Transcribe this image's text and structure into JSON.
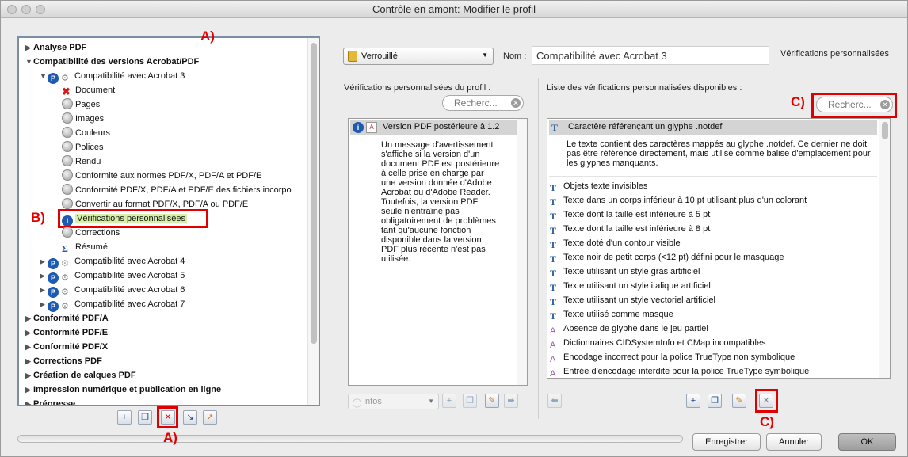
{
  "window": {
    "title": "Contrôle en amont: Modifier le profil"
  },
  "annotations": {
    "a_top": "A)",
    "a_bottom": "A)",
    "b": "B)",
    "c_top": "C)",
    "c_bottom": "C)"
  },
  "tree": {
    "items": [
      {
        "label": "Analyse PDF",
        "arrow": "▶",
        "bold": true,
        "indent": 0,
        "icon": ""
      },
      {
        "label": "Compatibilité des versions Acrobat/PDF",
        "arrow": "▼",
        "bold": true,
        "indent": 0,
        "icon": ""
      },
      {
        "label": "Compatibilité avec Acrobat 3",
        "arrow": "▼",
        "bold": false,
        "indent": 1,
        "icon": "profile-icon"
      },
      {
        "label": "Document",
        "arrow": "",
        "bold": false,
        "indent": 2,
        "icon": "error-x-icon"
      },
      {
        "label": "Pages",
        "arrow": "",
        "bold": false,
        "indent": 2,
        "icon": "disc-icon"
      },
      {
        "label": "Images",
        "arrow": "",
        "bold": false,
        "indent": 2,
        "icon": "disc-icon"
      },
      {
        "label": "Couleurs",
        "arrow": "",
        "bold": false,
        "indent": 2,
        "icon": "disc-icon"
      },
      {
        "label": "Polices",
        "arrow": "",
        "bold": false,
        "indent": 2,
        "icon": "disc-icon"
      },
      {
        "label": "Rendu",
        "arrow": "",
        "bold": false,
        "indent": 2,
        "icon": "disc-icon"
      },
      {
        "label": "Conformité aux normes PDF/X, PDF/A et PDF/E",
        "arrow": "",
        "bold": false,
        "indent": 2,
        "icon": "disc-icon"
      },
      {
        "label": "Conformité PDF/X, PDF/A et PDF/E des fichiers incorpo",
        "arrow": "",
        "bold": false,
        "indent": 2,
        "icon": "disc-icon"
      },
      {
        "label": "Convertir au format PDF/X, PDF/A ou PDF/E",
        "arrow": "",
        "bold": false,
        "indent": 2,
        "icon": "disc-icon"
      },
      {
        "label": "Vérifications personnalisées",
        "arrow": "",
        "bold": false,
        "indent": 2,
        "icon": "custom-check-icon",
        "selected": true
      },
      {
        "label": "Corrections",
        "arrow": "",
        "bold": false,
        "indent": 2,
        "icon": "disc-icon"
      },
      {
        "label": "Résumé",
        "arrow": "",
        "bold": false,
        "indent": 2,
        "icon": "summary-icon"
      },
      {
        "label": "Compatibilité avec Acrobat 4",
        "arrow": "▶",
        "bold": false,
        "indent": 1,
        "icon": "profile-icon"
      },
      {
        "label": "Compatibilité avec Acrobat 5",
        "arrow": "▶",
        "bold": false,
        "indent": 1,
        "icon": "profile-icon"
      },
      {
        "label": "Compatibilité avec Acrobat 6",
        "arrow": "▶",
        "bold": false,
        "indent": 1,
        "icon": "profile-icon"
      },
      {
        "label": "Compatibilité avec Acrobat 7",
        "arrow": "▶",
        "bold": false,
        "indent": 1,
        "icon": "profile-icon"
      },
      {
        "label": "Conformité PDF/A",
        "arrow": "▶",
        "bold": true,
        "indent": 0,
        "icon": ""
      },
      {
        "label": "Conformité PDF/E",
        "arrow": "▶",
        "bold": true,
        "indent": 0,
        "icon": ""
      },
      {
        "label": "Conformité PDF/X",
        "arrow": "▶",
        "bold": true,
        "indent": 0,
        "icon": ""
      },
      {
        "label": "Corrections PDF",
        "arrow": "▶",
        "bold": true,
        "indent": 0,
        "icon": ""
      },
      {
        "label": "Création de calques PDF",
        "arrow": "▶",
        "bold": true,
        "indent": 0,
        "icon": ""
      },
      {
        "label": "Impression numérique et publication en ligne",
        "arrow": "▶",
        "bold": true,
        "indent": 0,
        "icon": ""
      },
      {
        "label": "Prépresse",
        "arrow": "▶",
        "bold": true,
        "indent": 0,
        "icon": ""
      }
    ]
  },
  "header": {
    "lock_value": "Verrouillé",
    "name_label": "Nom :",
    "name_value": "Compatibilité avec Acrobat 3",
    "right_label": "Vérifications personnalisées"
  },
  "profile_checks": {
    "title": "Vérifications personnalisées du profil :",
    "search_placeholder": "Recherc...",
    "item_title": "Version PDF postérieure à 1.2",
    "item_desc": "Un message d'avertissement s'affiche si la version d'un document PDF est postérieure à celle prise en charge par une version donnée d'Adobe Acrobat ou d'Adobe Reader. Toutefois, la version PDF seule n'entraîne pas obligatoirement de problèmes tant qu'aucune fonction disponible dans la version PDF plus récente n'est pas utilisée.",
    "infos_label": "Infos"
  },
  "available_checks": {
    "title": "Liste des vérifications personnalisées disponibles :",
    "search_placeholder": "Recherc...",
    "selected_title": "Caractère référençant un glyphe .notdef",
    "selected_desc": "Le texte contient des caractères mappés au glyphe .notdef. Ce dernier ne doit pas être référencé directement, mais utilisé comme balise d'emplacement pour les glyphes manquants.",
    "items": [
      {
        "label": "Objets texte invisibles",
        "icon": "text-check-icon"
      },
      {
        "label": "Texte dans un corps inférieur à 10 pt utilisant plus d'un colorant",
        "icon": "text-check-icon"
      },
      {
        "label": "Texte dont la taille est inférieure à 5 pt",
        "icon": "text-check-icon"
      },
      {
        "label": "Texte dont la taille est inférieure à 8 pt",
        "icon": "text-check-icon"
      },
      {
        "label": "Texte doté d'un contour visible",
        "icon": "text-check-icon"
      },
      {
        "label": "Texte noir de petit corps (<12 pt) défini pour le masquage",
        "icon": "text-check-icon"
      },
      {
        "label": "Texte utilisant un style gras artificiel",
        "icon": "text-check-icon"
      },
      {
        "label": "Texte utilisant un style italique artificiel",
        "icon": "text-check-icon"
      },
      {
        "label": "Texte utilisant un style vectoriel artificiel",
        "icon": "text-check-icon"
      },
      {
        "label": "Texte utilisé comme masque",
        "icon": "text-check-icon"
      },
      {
        "label": "Absence de glyphe dans le jeu partiel",
        "icon": "font-check-icon"
      },
      {
        "label": "Dictionnaires CIDSystemInfo et CMap incompatibles",
        "icon": "font-check-icon"
      },
      {
        "label": "Encodage incorrect pour la police TrueType non symbolique",
        "icon": "font-check-icon"
      },
      {
        "label": "Entrée d'encodage interdite pour la police TrueType symbolique",
        "icon": "font-check-icon"
      }
    ]
  },
  "footer": {
    "save_label": "Enregistrer",
    "cancel_label": "Annuler",
    "ok_label": "OK"
  },
  "colors": {
    "annotation_red": "#e00000",
    "selection_blue": "#cfe0f7",
    "selected_row": "#d4d4d4"
  }
}
